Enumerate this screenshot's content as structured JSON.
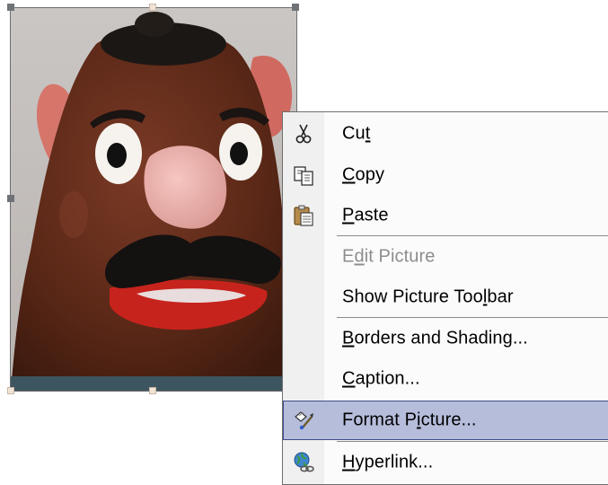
{
  "picture": {
    "icon": "potato-head-photo"
  },
  "context_menu": {
    "items": [
      {
        "key": "cut",
        "icon": "scissors-icon",
        "before": "Cu",
        "mnemonic": "t",
        "after": "",
        "enabled": true,
        "highlighted": false
      },
      {
        "key": "copy",
        "icon": "copy-icon",
        "before": "",
        "mnemonic": "C",
        "after": "opy",
        "enabled": true,
        "highlighted": false
      },
      {
        "key": "paste",
        "icon": "clipboard-icon",
        "before": "",
        "mnemonic": "P",
        "after": "aste",
        "enabled": true,
        "highlighted": false
      },
      {
        "key": "edit-picture",
        "icon": "",
        "before": "E",
        "mnemonic": "d",
        "after": "it Picture",
        "enabled": false,
        "highlighted": false
      },
      {
        "key": "show-picture-toolbar",
        "icon": "",
        "before": "Show Picture Too",
        "mnemonic": "l",
        "after": "bar",
        "enabled": true,
        "highlighted": false
      },
      {
        "key": "borders-and-shading",
        "icon": "",
        "before": "",
        "mnemonic": "B",
        "after": "orders and Shading...",
        "enabled": true,
        "highlighted": false
      },
      {
        "key": "caption",
        "icon": "",
        "before": "",
        "mnemonic": "C",
        "after": "aption...",
        "enabled": true,
        "highlighted": false
      },
      {
        "key": "format-picture",
        "icon": "format-picture-icon",
        "before": "Format P",
        "mnemonic": "i",
        "after": "cture...",
        "enabled": true,
        "highlighted": true
      },
      {
        "key": "hyperlink",
        "icon": "globe-link-icon",
        "before": "",
        "mnemonic": "H",
        "after": "yperlink...",
        "enabled": true,
        "highlighted": false
      }
    ],
    "colors": {
      "highlight_fill": "#b6bddb",
      "highlight_border": "#3e4a8a",
      "disabled_text": "#8d8d8d",
      "gutter": "#f0f0f0"
    }
  }
}
